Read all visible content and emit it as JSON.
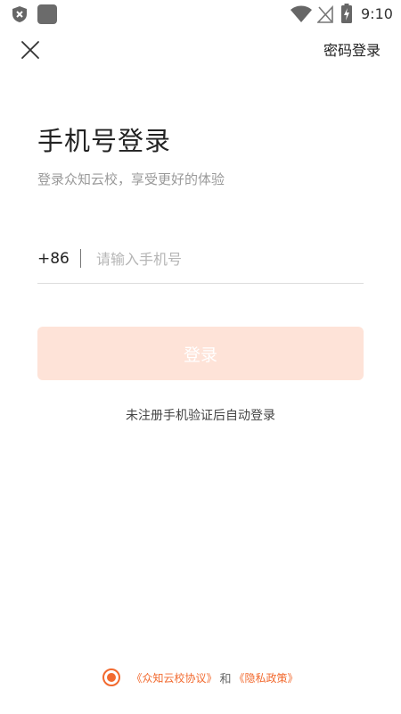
{
  "status_bar": {
    "time": "9:10",
    "icons": [
      "shield-icon",
      "app-square-icon",
      "wifi-icon",
      "no-signal-icon",
      "battery-charging-icon"
    ]
  },
  "header": {
    "close_icon": "close-icon",
    "password_login": "密码登录"
  },
  "main": {
    "title": "手机号登录",
    "subtitle": "登录众知云校，享受更好的体验",
    "phone": {
      "country_code": "+86",
      "value": "",
      "placeholder": "请输入手机号"
    },
    "login_button": "登录",
    "hint": "未注册手机验证后自动登录"
  },
  "agreement": {
    "checked": true,
    "link1": "《众知云校协议》",
    "and": "和",
    "link2": "《隐私政策》"
  },
  "colors": {
    "accent": "#f26a2f",
    "button_disabled_bg": "#fee3d8",
    "placeholder": "#b5b5b5",
    "divider": "#dddddd"
  }
}
